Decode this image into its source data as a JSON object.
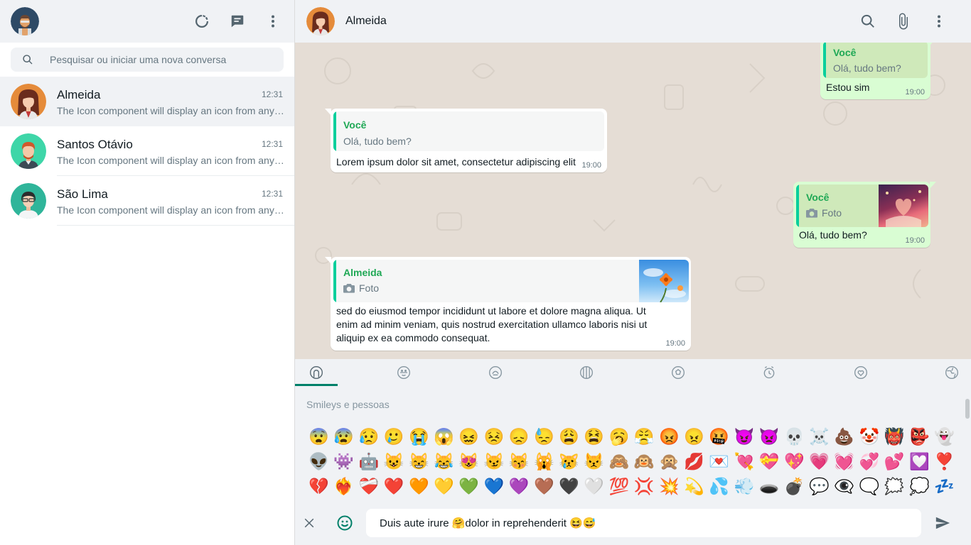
{
  "sidebar": {
    "search": {
      "placeholder": "Pesquisar ou iniciar uma nova conversa"
    },
    "chats": [
      {
        "name": "Almeida",
        "time": "12:31",
        "preview": "The Icon component will display an icon from any icon set."
      },
      {
        "name": "Santos Otávio",
        "time": "12:31",
        "preview": "The Icon component will display an icon from any icon set."
      },
      {
        "name": "São Lima",
        "time": "12:31",
        "preview": "The Icon component will display an icon from any icon set."
      }
    ]
  },
  "conversation": {
    "contact_name": "Almeida",
    "messages": [
      {
        "direction": "out",
        "quote_author": "Você",
        "quote_text": "Olá, tudo bem?",
        "text": "Estou sim",
        "time": "19:00"
      },
      {
        "direction": "in",
        "quote_author": "Você",
        "quote_text": "Olá, tudo bem?",
        "text": "Lorem ipsum dolor sit amet, consectetur adipiscing elit",
        "time": "19:00"
      },
      {
        "direction": "out",
        "quote_author": "Você",
        "quote_text": "Foto",
        "text": "Olá, tudo bem?",
        "time": "19:00"
      },
      {
        "direction": "in",
        "quote_author": "Almeida",
        "quote_text": "Foto",
        "text_lines": [
          "sed do eiusmod tempor incididunt ut labore et dolore magna aliqua. Ut",
          "enim ad minim veniam, quis nostrud exercitation ullamco laboris nisi ut",
          "aliquip ex ea commodo consequat."
        ],
        "time": "19:00"
      }
    ]
  },
  "emoji_panel": {
    "category_title": "Smileys e pessoas",
    "tabs": [
      "smileys-icon",
      "animals-icon",
      "food-icon",
      "activity-icon",
      "sports-icon",
      "travel-icon",
      "objects-icon",
      "symbols-icon"
    ],
    "rows": [
      [
        "😨",
        "😰",
        "😥",
        "🥲",
        "😭",
        "😱",
        "😖",
        "😣",
        "😞",
        "😓",
        "😩",
        "😫",
        "🥱",
        "😤",
        "😡",
        "😠",
        "🤬",
        "😈",
        "👿",
        "💀",
        "☠️",
        "💩",
        "🤡",
        "👹",
        "👺",
        "👻"
      ],
      [
        "👽",
        "👾",
        "🤖",
        "😺",
        "😸",
        "😹",
        "😻",
        "😼",
        "😽",
        "🙀",
        "😿",
        "😾",
        "🙈",
        "🙉",
        "🙊",
        "💋",
        "💌",
        "💘",
        "💝",
        "💖",
        "💗",
        "💓",
        "💞",
        "💕",
        "💟",
        "❣️"
      ],
      [
        "💔",
        "❤️‍🔥",
        "❤️‍🩹",
        "❤️",
        "🧡",
        "💛",
        "💚",
        "💙",
        "💜",
        "🤎",
        "🖤",
        "🤍",
        "💯",
        "💢",
        "💥",
        "💫",
        "💦",
        "💨",
        "🕳️",
        "💣",
        "💬",
        "👁️‍🗨️",
        "🗨️",
        "🗯️",
        "💭",
        "💤"
      ]
    ]
  },
  "compose": {
    "message": "Duis aute irure 🤗dolor in reprehenderit 😆😅"
  },
  "colors": {
    "accent": "#008069",
    "quote_bar": "#06cf9c",
    "quote_author": "#1fa855",
    "out_bubble": "#d9fdd3",
    "chat_bg": "#e5ddd5"
  }
}
